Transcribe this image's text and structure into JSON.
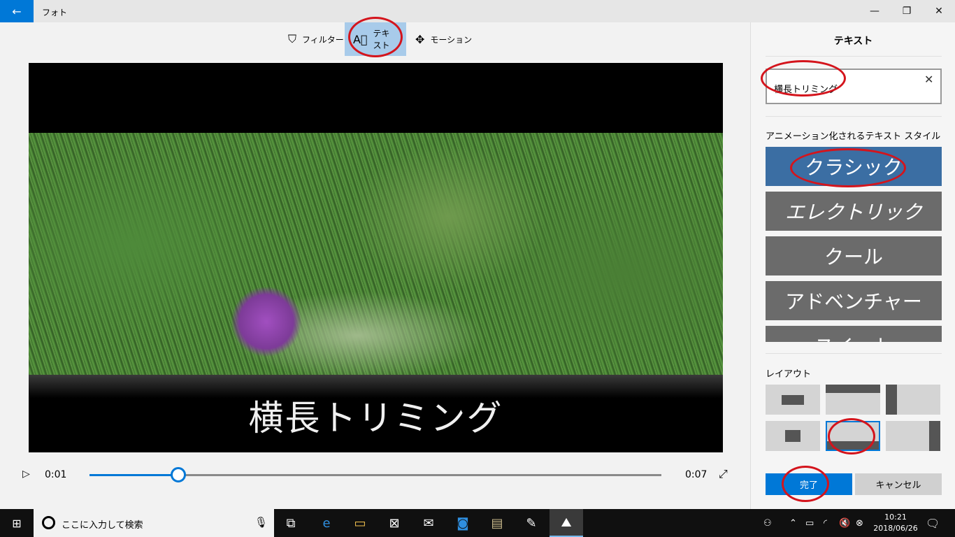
{
  "window": {
    "app_title": "フォト"
  },
  "toolbar": {
    "filter_label": "フィルター",
    "text_label": "テキスト",
    "motion_label": "モーション"
  },
  "video": {
    "caption": "横長トリミング"
  },
  "player": {
    "current_time": "0:01",
    "duration": "0:07",
    "progress": 0.155
  },
  "panel": {
    "title": "テキスト",
    "text_value": "横長トリミング",
    "styles_label": "アニメーション化されるテキスト スタイル",
    "styles": [
      "クラシック",
      "エレクトリック",
      "クール",
      "アドベンチャー",
      "スイート"
    ],
    "selected_style": "クラシック",
    "layout_label": "レイアウト",
    "done_label": "完了",
    "cancel_label": "キャンセル"
  },
  "taskbar": {
    "search_placeholder": "ここに入力して検索",
    "time": "10:21",
    "date": "2018/06/26"
  },
  "colors": {
    "accent": "#0078d7",
    "annotation": "#d4141c",
    "selected_style": "#3b6ea3"
  }
}
